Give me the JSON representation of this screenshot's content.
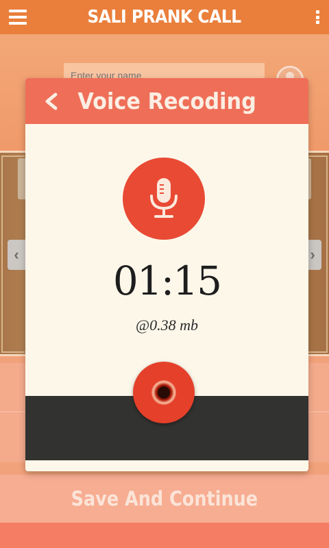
{
  "appbar": {
    "title": "SALI PRANK CALL",
    "menu_icon": "hamburger-menu-icon",
    "overflow_icon": "more-vertical-icon"
  },
  "form": {
    "name_placeholder": "Enter your name",
    "contact_icon": "contact-person-icon"
  },
  "carousel": {
    "prev_arrow": "‹",
    "next_arrow": "›"
  },
  "dialog": {
    "title": "Voice Recoding",
    "back_icon": "chevron-left-icon",
    "mic_icon": "microphone-icon",
    "timer": "01:15",
    "filesize": "@0.38 mb",
    "record_icon": "record-icon"
  },
  "footer": {
    "save_label": "Save And Continue"
  },
  "colors": {
    "appbar": "#ea7f3b",
    "dialog_header": "#ef6e58",
    "mic_button": "#e94a34",
    "dialog_body": "#fdf7ea",
    "dark_bar": "#323230"
  }
}
